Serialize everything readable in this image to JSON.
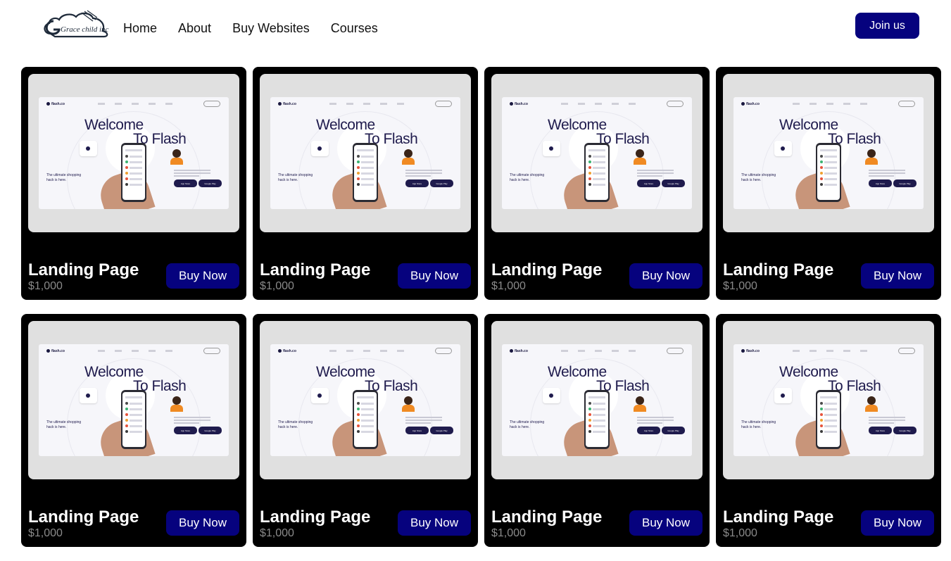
{
  "header": {
    "logo_text": "Grace child inc",
    "nav": [
      "Home",
      "About",
      "Buy Websites",
      "Courses"
    ],
    "join_label": "Join us"
  },
  "colors": {
    "accent": "#06027e",
    "card_bg": "#000000",
    "thumb_bg": "#e0e0e0",
    "price": "#8a8a8a"
  },
  "products": [
    {
      "title": "Landing Page",
      "price": "$1,000",
      "button": "Buy Now",
      "preview": {
        "brand": "flash.co",
        "headline_1": "Welcome",
        "headline_2": "To Flash",
        "subtitle": "The ultimate shopping hack is here.",
        "store_1": "App Store",
        "store_2": "Google Play"
      }
    },
    {
      "title": "Landing Page",
      "price": "$1,000",
      "button": "Buy Now",
      "preview": {
        "brand": "flash.co",
        "headline_1": "Welcome",
        "headline_2": "To Flash",
        "subtitle": "The ultimate shopping hack is here.",
        "store_1": "App Store",
        "store_2": "Google Play"
      }
    },
    {
      "title": "Landing Page",
      "price": "$1,000",
      "button": "Buy Now",
      "preview": {
        "brand": "flash.co",
        "headline_1": "Welcome",
        "headline_2": "To Flash",
        "subtitle": "The ultimate shopping hack is here.",
        "store_1": "App Store",
        "store_2": "Google Play"
      }
    },
    {
      "title": "Landing Page",
      "price": "$1,000",
      "button": "Buy Now",
      "preview": {
        "brand": "flash.co",
        "headline_1": "Welcome",
        "headline_2": "To Flash",
        "subtitle": "The ultimate shopping hack is here.",
        "store_1": "App Store",
        "store_2": "Google Play"
      }
    },
    {
      "title": "Landing Page",
      "price": "$1,000",
      "button": "Buy Now",
      "preview": {
        "brand": "flash.co",
        "headline_1": "Welcome",
        "headline_2": "To Flash",
        "subtitle": "The ultimate shopping hack is here.",
        "store_1": "App Store",
        "store_2": "Google Play"
      }
    },
    {
      "title": "Landing Page",
      "price": "$1,000",
      "button": "Buy Now",
      "preview": {
        "brand": "flash.co",
        "headline_1": "Welcome",
        "headline_2": "To Flash",
        "subtitle": "The ultimate shopping hack is here.",
        "store_1": "App Store",
        "store_2": "Google Play"
      }
    },
    {
      "title": "Landing Page",
      "price": "$1,000",
      "button": "Buy Now",
      "preview": {
        "brand": "flash.co",
        "headline_1": "Welcome",
        "headline_2": "To Flash",
        "subtitle": "The ultimate shopping hack is here.",
        "store_1": "App Store",
        "store_2": "Google Play"
      }
    },
    {
      "title": "Landing Page",
      "price": "$1,000",
      "button": "Buy Now",
      "preview": {
        "brand": "flash.co",
        "headline_1": "Welcome",
        "headline_2": "To Flash",
        "subtitle": "The ultimate shopping hack is here.",
        "store_1": "App Store",
        "store_2": "Google Play"
      }
    }
  ]
}
